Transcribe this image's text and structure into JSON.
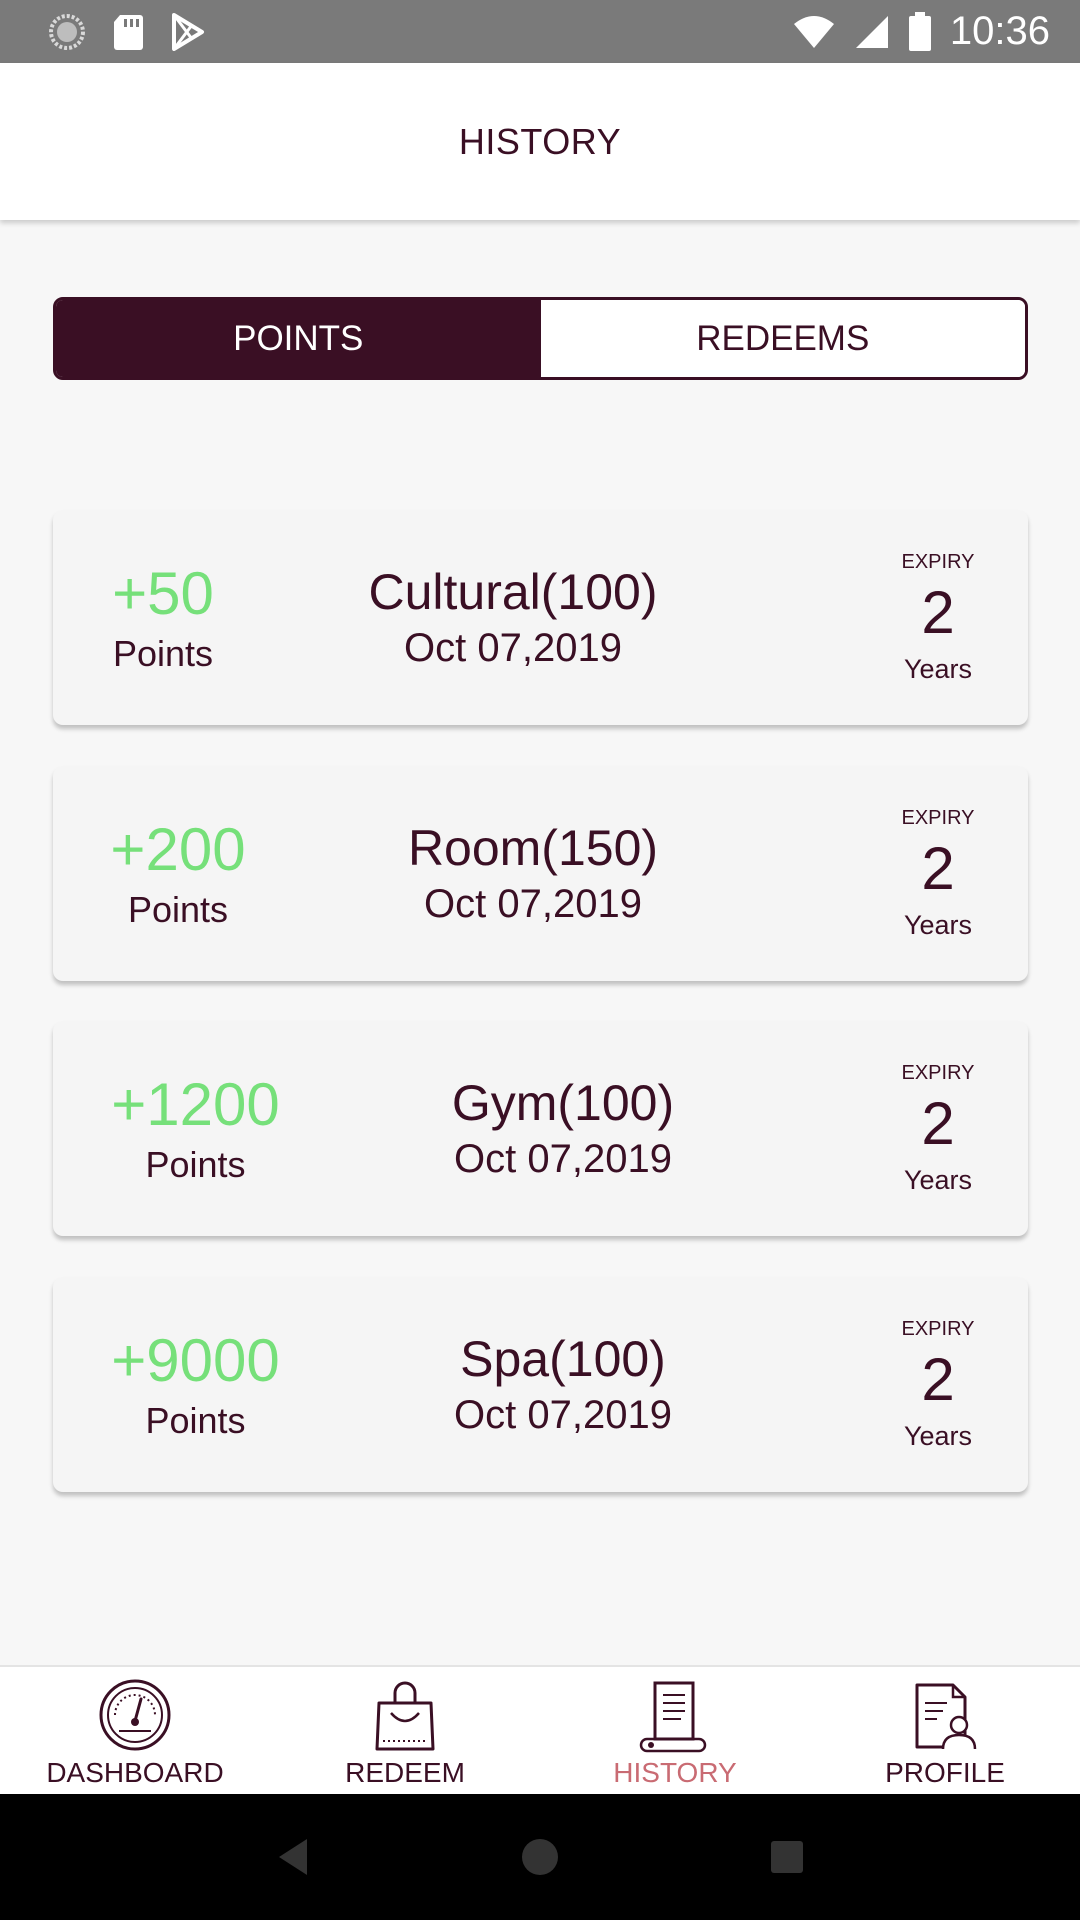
{
  "status_bar": {
    "time": "10:36",
    "left_icons": [
      "sync-icon",
      "sd-card-icon",
      "play-store-icon"
    ],
    "right_icons": [
      "wifi-icon",
      "signal-icon",
      "battery-icon"
    ]
  },
  "header": {
    "title": "HISTORY"
  },
  "tabs": [
    {
      "label": "POINTS",
      "active": true
    },
    {
      "label": "REDEEMS",
      "active": false
    }
  ],
  "history": [
    {
      "points": "+50",
      "points_label": "Points",
      "category": "Cultural(100)",
      "date": "Oct 07,2019",
      "expiry_label": "EXPIRY",
      "expiry_value": "2",
      "expiry_unit": "Years"
    },
    {
      "points": "+200",
      "points_label": "Points",
      "category": "Room(150)",
      "date": "Oct 07,2019",
      "expiry_label": "EXPIRY",
      "expiry_value": "2",
      "expiry_unit": "Years"
    },
    {
      "points": "+1200",
      "points_label": "Points",
      "category": "Gym(100)",
      "date": "Oct 07,2019",
      "expiry_label": "EXPIRY",
      "expiry_value": "2",
      "expiry_unit": "Years"
    },
    {
      "points": "+9000",
      "points_label": "Points",
      "category": "Spa(100)",
      "date": "Oct 07,2019",
      "expiry_label": "EXPIRY",
      "expiry_value": "2",
      "expiry_unit": "Years"
    }
  ],
  "bottom_nav": [
    {
      "label": "DASHBOARD",
      "icon": "dashboard-gauge-icon",
      "active": false
    },
    {
      "label": "REDEEM",
      "icon": "shopping-bag-icon",
      "active": false
    },
    {
      "label": "HISTORY",
      "icon": "history-scroll-icon",
      "active": true
    },
    {
      "label": "PROFILE",
      "icon": "profile-document-icon",
      "active": false
    }
  ],
  "colors": {
    "primary": "#3a0f24",
    "points_green": "#76e07a",
    "active_nav": "#c96b73",
    "status_bar": "#7a7a7a"
  }
}
